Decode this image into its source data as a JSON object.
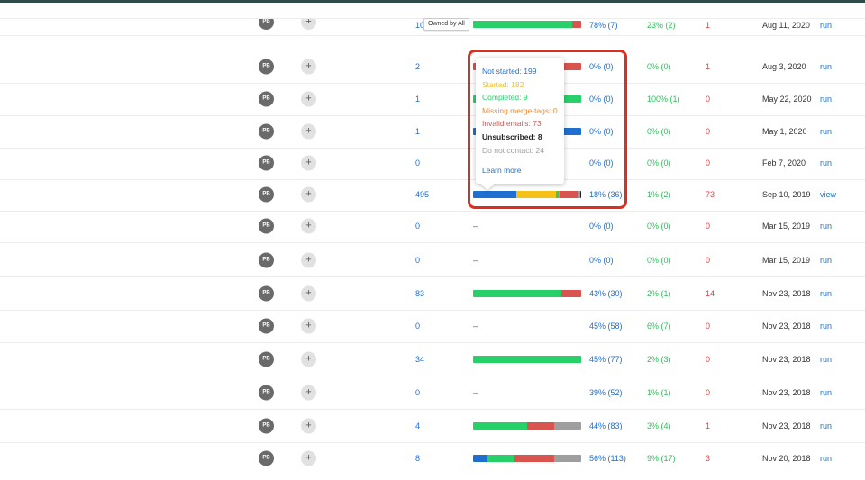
{
  "header": {
    "owned_filter": "Owned by All"
  },
  "colors": {
    "not_started": "#1e6fd0",
    "started": "#f5c118",
    "completed": "#28d06a",
    "missing_merge_tags": "#f08a2e",
    "invalid_emails": "#d9534f",
    "unsubscribed": "#222222",
    "do_not_contact": "#9e9e9e",
    "highlight_box": "#e32b1f"
  },
  "tooltip": {
    "not_started": "Not started: 199",
    "started": "Started: 182",
    "completed": "Completed: 9",
    "missing_merge_tags": "Missing merge-tags: 0",
    "invalid_emails": "Invalid emails: 73",
    "unsubscribed": "Unsubscribed: 8",
    "do_not_contact": "Do not contact: 24",
    "learn_more": "Learn more"
  },
  "rows": [
    {
      "avatar": "PB",
      "plus": "+",
      "count": "10",
      "bar": [
        0,
        0,
        92,
        0,
        8,
        0
      ],
      "dash": "",
      "pct_opened": "78% (7)",
      "pct_green": "23% (2)",
      "red_num": "1",
      "date": "Aug 11, 2020",
      "action": "run"
    },
    {
      "avatar": "PB",
      "plus": "+",
      "count": "2",
      "bar": [
        0,
        0,
        0,
        0,
        100,
        0
      ],
      "dash": "",
      "pct_opened": "0% (0)",
      "pct_green": "0% (0)",
      "red_num": "1",
      "date": "Aug 3, 2020",
      "action": "run"
    },
    {
      "avatar": "PB",
      "plus": "+",
      "count": "1",
      "bar": [
        0,
        0,
        100,
        0,
        0,
        0
      ],
      "dash": "",
      "pct_opened": "0% (0)",
      "pct_green": "100% (1)",
      "red_num": "0",
      "date": "May 22, 2020",
      "action": "run"
    },
    {
      "avatar": "PB",
      "plus": "+",
      "count": "1",
      "bar": [
        100,
        0,
        0,
        0,
        0,
        0
      ],
      "dash": "",
      "pct_opened": "0% (0)",
      "pct_green": "0% (0)",
      "red_num": "0",
      "date": "May 1, 2020",
      "action": "run"
    },
    {
      "avatar": "PB",
      "plus": "+",
      "count": "0",
      "bar": [],
      "dash": "",
      "pct_opened": "0% (0)",
      "pct_green": "0% (0)",
      "red_num": "0",
      "date": "Feb 7, 2020",
      "action": "run"
    },
    {
      "avatar": "PB",
      "plus": "+",
      "count": "495",
      "bar": [
        40,
        37,
        2,
        1,
        17,
        2,
        1
      ],
      "dash": "",
      "pct_opened": "18% (36)",
      "pct_green": "1% (2)",
      "red_num": "73",
      "date": "Sep 10, 2019",
      "action": "view"
    },
    {
      "avatar": "PB",
      "plus": "+",
      "count": "0",
      "bar": [],
      "dash": "–",
      "pct_opened": "0% (0)",
      "pct_green": "0% (0)",
      "red_num": "0",
      "date": "Mar 15, 2019",
      "action": "run"
    },
    {
      "avatar": "PB",
      "plus": "+",
      "count": "0",
      "bar": [],
      "dash": "–",
      "pct_opened": "0% (0)",
      "pct_green": "0% (0)",
      "red_num": "0",
      "date": "Mar 15, 2019",
      "action": "run"
    },
    {
      "avatar": "PB",
      "plus": "+",
      "count": "83",
      "bar": [
        0,
        0,
        82,
        0,
        18,
        0
      ],
      "dash": "",
      "pct_opened": "43% (30)",
      "pct_green": "2% (1)",
      "red_num": "14",
      "date": "Nov 23, 2018",
      "action": "run"
    },
    {
      "avatar": "PB",
      "plus": "+",
      "count": "0",
      "bar": [],
      "dash": "–",
      "pct_opened": "45% (58)",
      "pct_green": "6% (7)",
      "red_num": "0",
      "date": "Nov 23, 2018",
      "action": "run"
    },
    {
      "avatar": "PB",
      "plus": "+",
      "count": "34",
      "bar": [
        0,
        0,
        100,
        0,
        0,
        0
      ],
      "dash": "",
      "pct_opened": "45% (77)",
      "pct_green": "2% (3)",
      "red_num": "0",
      "date": "Nov 23, 2018",
      "action": "run"
    },
    {
      "avatar": "PB",
      "plus": "+",
      "count": "0",
      "bar": [],
      "dash": "–",
      "pct_opened": "39% (52)",
      "pct_green": "1% (1)",
      "red_num": "0",
      "date": "Nov 23, 2018",
      "action": "run"
    },
    {
      "avatar": "PB",
      "plus": "+",
      "count": "4",
      "bar": [
        0,
        0,
        50,
        0,
        25,
        25
      ],
      "dash": "",
      "pct_opened": "44% (83)",
      "pct_green": "3% (4)",
      "red_num": "1",
      "date": "Nov 23, 2018",
      "action": "run"
    },
    {
      "avatar": "PB",
      "plus": "+",
      "count": "8",
      "bar": [
        13,
        0,
        25,
        0,
        37,
        25
      ],
      "dash": "",
      "pct_opened": "56% (113)",
      "pct_green": "9% (17)",
      "red_num": "3",
      "date": "Nov 20, 2018",
      "action": "run"
    }
  ]
}
